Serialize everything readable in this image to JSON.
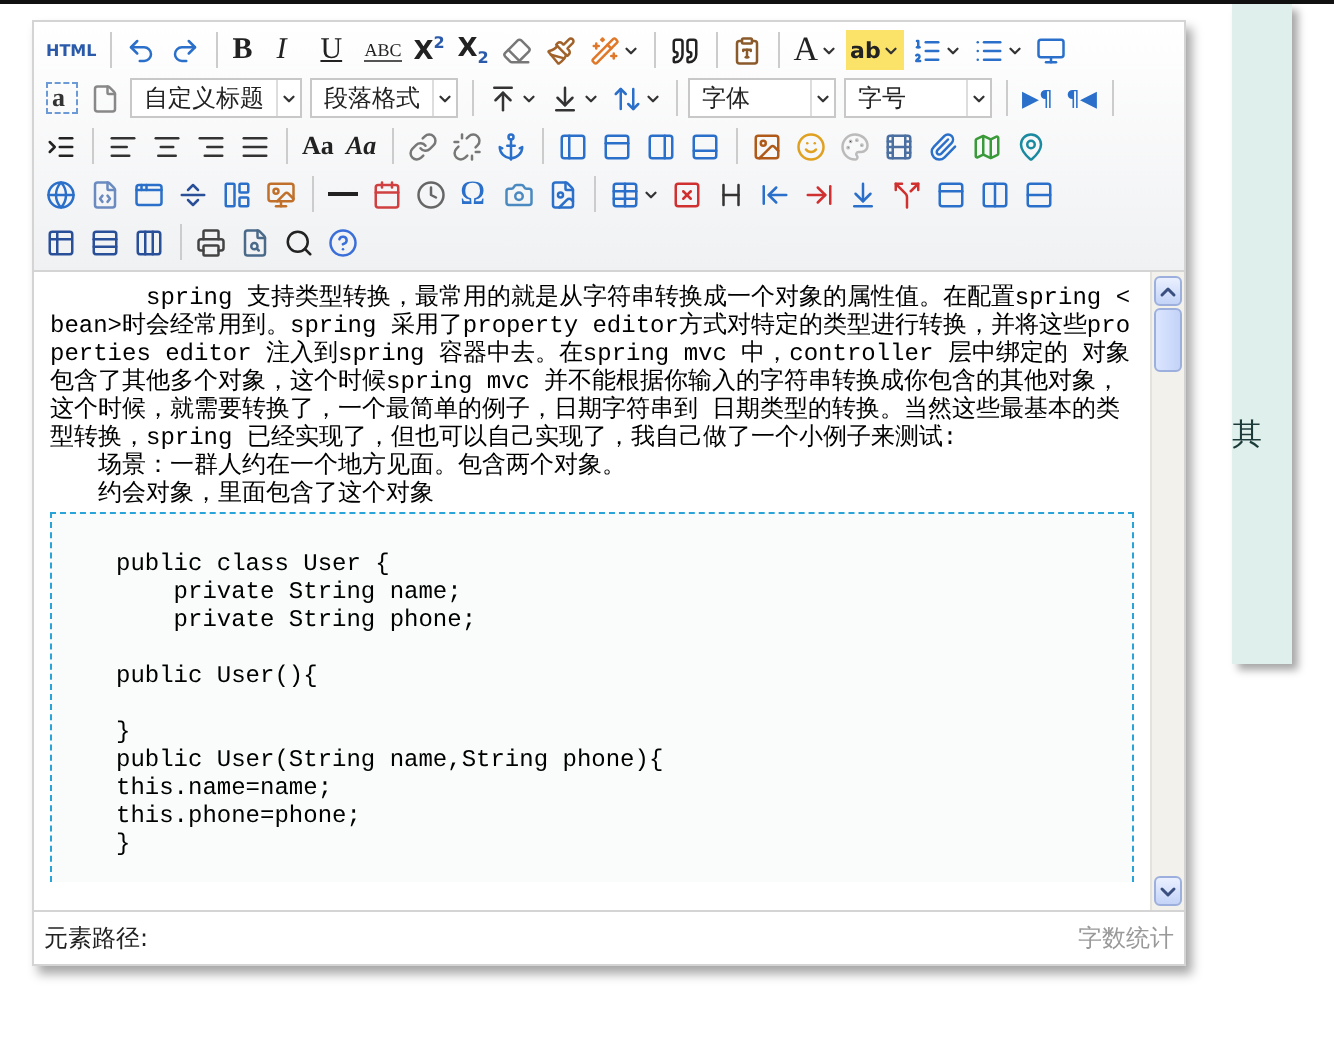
{
  "toolbar": {
    "rows": [
      {
        "items": [
          {
            "kind": "glyph",
            "label": "HTML"
          },
          {
            "kind": "separator"
          },
          {
            "kind": "icon"
          },
          {
            "kind": "icon"
          },
          {
            "kind": "separator"
          },
          {
            "kind": "glyph",
            "label": "B"
          },
          {
            "kind": "glyph",
            "label": "I"
          },
          {
            "kind": "glyph",
            "label": "U"
          },
          {
            "kind": "glyph",
            "label": "ABC"
          },
          {
            "kind": "glyph",
            "label": "X$^{2}$"
          },
          {
            "kind": "glyph",
            "label": "X$_{2}$"
          },
          {
            "kind": "icon"
          },
          {
            "kind": "icon"
          },
          {
            "kind": "icon",
            "has_menu": true
          },
          {
            "kind": "separator"
          },
          {
            "kind": "icon"
          },
          {
            "kind": "separator"
          },
          {
            "kind": "icon"
          },
          {
            "kind": "separator"
          },
          {
            "kind": "glyph",
            "label": "A",
            "has_menu": true
          },
          {
            "kind": "glyph",
            "label": "ab",
            "has_menu": true
          },
          {
            "kind": "icon",
            "has_menu": true
          },
          {
            "kind": "icon",
            "has_menu": true
          },
          {
            "kind": "icon"
          }
        ]
      },
      {
        "items": [
          {
            "kind": "glyph",
            "label": "a"
          },
          {
            "kind": "icon"
          },
          {
            "kind": "select",
            "value": "自定义标题"
          },
          {
            "kind": "select",
            "value": "段落格式"
          },
          {
            "kind": "separator"
          },
          {
            "kind": "icon",
            "has_menu": true
          },
          {
            "kind": "icon",
            "has_menu": true
          },
          {
            "kind": "icon",
            "has_menu": true
          },
          {
            "kind": "separator"
          },
          {
            "kind": "select",
            "value": "字体"
          },
          {
            "kind": "select",
            "value": "字号"
          },
          {
            "kind": "separator"
          },
          {
            "kind": "glyph",
            "label": "▶¶"
          },
          {
            "kind": "glyph",
            "label": "¶◀"
          },
          {
            "kind": "separator"
          }
        ]
      },
      {
        "items": [
          {
            "kind": "icon"
          },
          {
            "kind": "separator"
          },
          {
            "kind": "icon"
          },
          {
            "kind": "icon"
          },
          {
            "kind": "icon"
          },
          {
            "kind": "icon"
          },
          {
            "kind": "separator"
          },
          {
            "kind": "glyph",
            "label": "Aa"
          },
          {
            "kind": "glyph",
            "label": "Aa"
          },
          {
            "kind": "separator"
          },
          {
            "kind": "icon"
          },
          {
            "kind": "icon"
          },
          {
            "kind": "icon"
          },
          {
            "kind": "separator"
          },
          {
            "kind": "icon"
          },
          {
            "kind": "icon"
          },
          {
            "kind": "icon"
          },
          {
            "kind": "icon"
          },
          {
            "kind": "separator"
          },
          {
            "kind": "icon"
          },
          {
            "kind": "icon"
          },
          {
            "kind": "icon"
          },
          {
            "kind": "icon"
          },
          {
            "kind": "icon"
          },
          {
            "kind": "icon"
          },
          {
            "kind": "icon"
          }
        ]
      },
      {
        "items": [
          {
            "kind": "icon"
          },
          {
            "kind": "icon"
          },
          {
            "kind": "icon"
          },
          {
            "kind": "icon"
          },
          {
            "kind": "icon"
          },
          {
            "kind": "icon"
          },
          {
            "kind": "separator"
          },
          {
            "kind": "icon"
          },
          {
            "kind": "icon"
          },
          {
            "kind": "icon"
          },
          {
            "kind": "glyph",
            "label": "Ω"
          },
          {
            "kind": "icon"
          },
          {
            "kind": "icon"
          },
          {
            "kind": "separator"
          },
          {
            "kind": "icon",
            "has_menu": true
          },
          {
            "kind": "icon"
          },
          {
            "kind": "icon"
          },
          {
            "kind": "icon"
          },
          {
            "kind": "icon"
          },
          {
            "kind": "icon"
          },
          {
            "kind": "icon"
          },
          {
            "kind": "icon"
          },
          {
            "kind": "icon"
          },
          {
            "kind": "icon"
          }
        ]
      },
      {
        "items": [
          {
            "kind": "icon"
          },
          {
            "kind": "icon"
          },
          {
            "kind": "icon"
          },
          {
            "kind": "separator"
          },
          {
            "kind": "icon"
          },
          {
            "kind": "icon"
          },
          {
            "kind": "icon"
          },
          {
            "kind": "icon"
          }
        ]
      }
    ]
  },
  "content": {
    "paragraph": "spring  支持类型转换，最常用的就是从字符串转换成一个对象的属性值。在配置spring <bean>时会经常用到。spring 采用了property editor方式对特定的类型进行转换，并将这些properties editor 注入到spring 容器中去。在spring mvc  中，controller 层中绑定的 对象包含了其他多个对象，这个时候spring mvc 并不能根据你输入的字符串转换成你包含的其他对象，这个时候，就需要转换了，一个最简单的例子，日期字符串到 日期类型的转换。当然这些最基本的类型转换，spring 已经实现了，但也可以自己实现了，我自己做了一个小例子来测试:",
    "lines": [
      "场景：一群人约在一个地方见面。包含两个对象。",
      "约会对象，里面包含了这个对象"
    ],
    "code_blocks": [
      {
        "lines": [
          "public class User {",
          "    private String name;",
          "    private String phone;"
        ]
      },
      {
        "lines": [
          "public User(){"
        ]
      },
      {
        "lines": [
          "}",
          "public User(String name,String phone){",
          "this.name=name;",
          "this.phone=phone;",
          "}"
        ]
      }
    ]
  },
  "status_bar": {
    "path_label": "元素路径:",
    "word_count": "字数统计"
  },
  "side_panel": {
    "text": "其"
  }
}
